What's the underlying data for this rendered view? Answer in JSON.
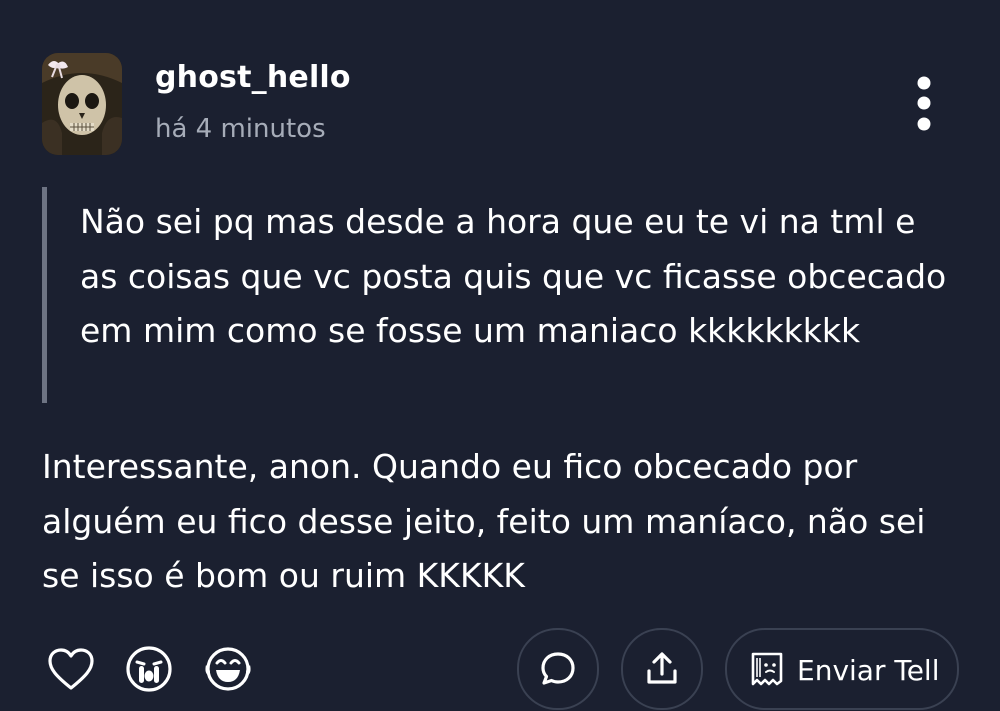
{
  "post": {
    "username": "ghost_hello",
    "timestamp": "há 4 minutos",
    "question": "Não sei pq mas desde a hora que eu te vi na tml e as coisas que vc posta quis que vc ficasse obcecado em mim como se fosse um maniaco kkkkkkkkk",
    "answer": "Interessante, anon. Quando eu fico obcecado por alguém eu fico desse jeito, feito um maníaco, não sei se isso é bom ou ruim KKKKK"
  },
  "actions": {
    "send_tell_label": "Enviar Tell"
  },
  "icons": {
    "more": "more-vertical-icon",
    "like": "heart-icon",
    "sad": "crying-face-icon",
    "laugh": "laughing-face-icon",
    "comment": "comment-bubble-icon",
    "share": "share-upload-icon",
    "tell": "tell-paper-icon"
  },
  "colors": {
    "background": "#1b2030",
    "text": "#ffffff",
    "muted": "#a6acb8",
    "quote_bar": "#6e7483",
    "pill_border": "#3a4152"
  }
}
